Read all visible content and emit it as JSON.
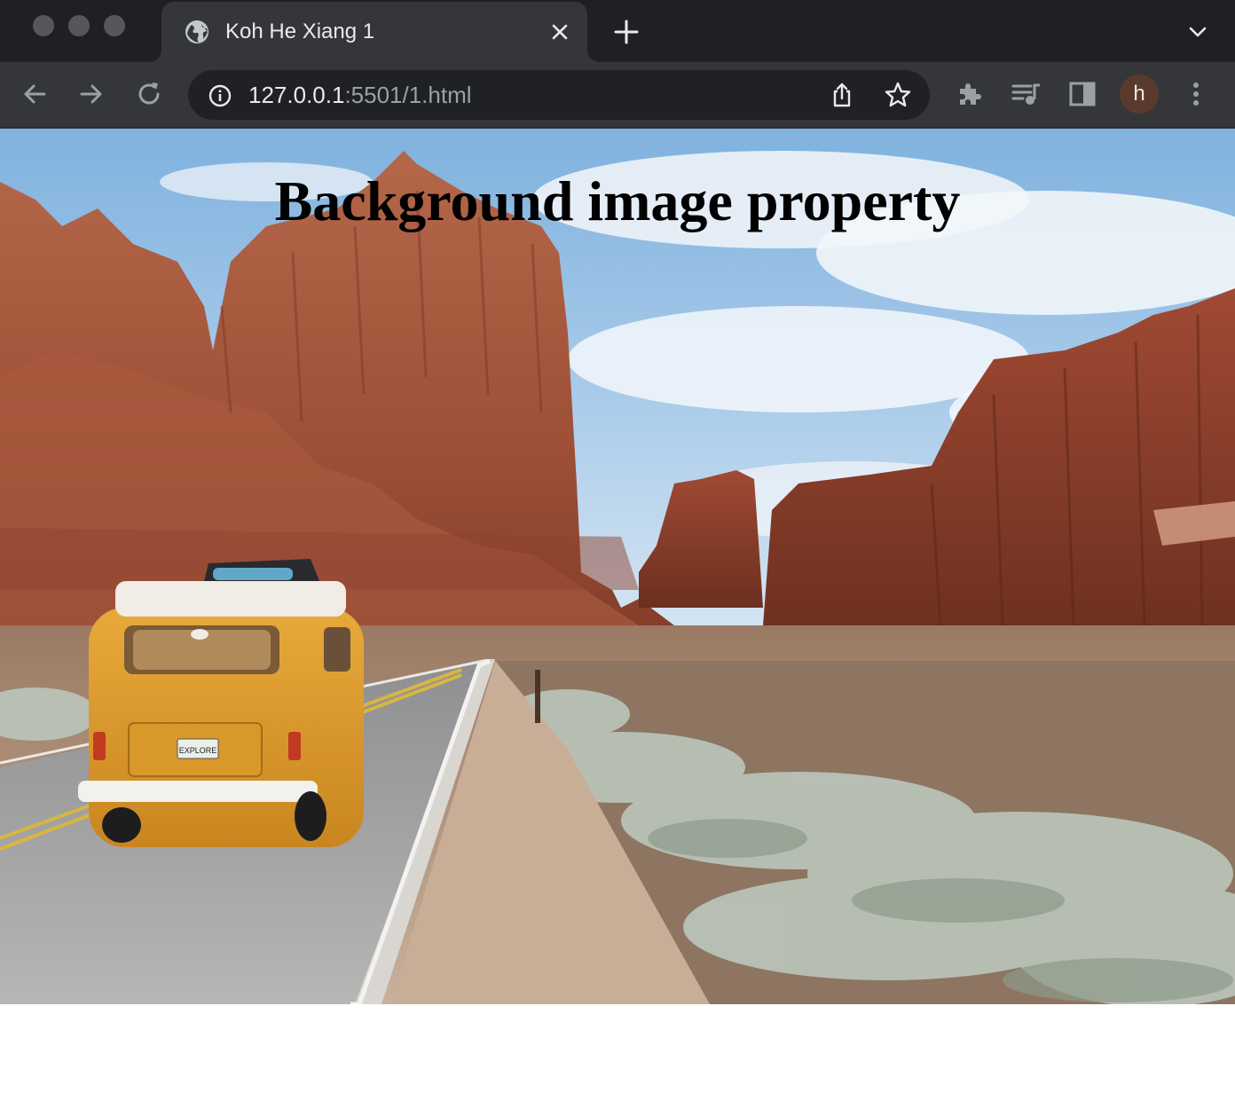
{
  "browser": {
    "tab": {
      "title": "Koh He Xiang 1",
      "favicon": "globe-icon"
    },
    "address_bar": {
      "url_host": "127.0.0.1",
      "url_rest": ":5501/1.html",
      "info_icon": "info-icon"
    },
    "profile": {
      "initial": "h",
      "color": "#5b3a2e"
    },
    "icons": [
      "back-arrow-icon",
      "forward-arrow-icon",
      "reload-icon",
      "share-icon",
      "bookmark-star-icon",
      "extensions-puzzle-icon",
      "media-queue-icon",
      "side-panel-icon",
      "more-menu-icon",
      "new-tab-plus-icon",
      "close-icon",
      "tab-search-chevron-icon"
    ]
  },
  "page": {
    "heading": "Background image property",
    "background_image": {
      "description_icon": "desert-road-van-image",
      "van_plate": "EXPLORE"
    }
  },
  "colors": {
    "tabstrip": "#1f2023",
    "toolbar": "#35363a",
    "omnibox": "#202124",
    "text_primary": "#e8eaed",
    "text_secondary": "#9aa0a6"
  }
}
